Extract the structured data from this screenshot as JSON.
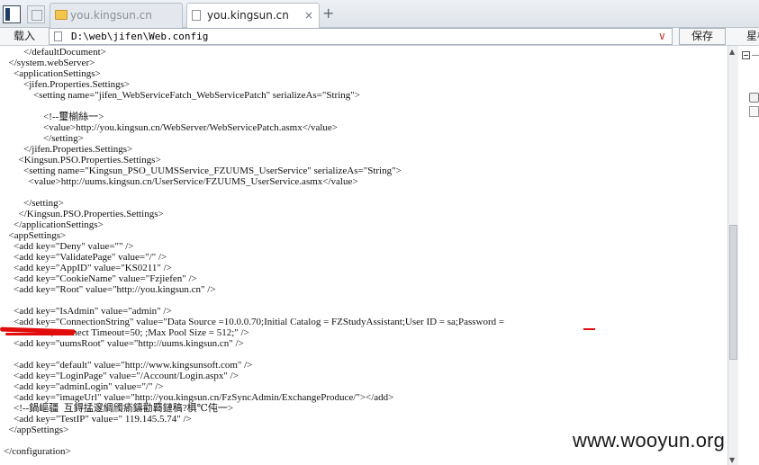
{
  "tabs": [
    {
      "label": "you.kingsun.cn",
      "icon": "folder-icon",
      "active": false
    },
    {
      "label": "you.kingsun.cn",
      "icon": "file-icon",
      "active": true
    }
  ],
  "tab_close_glyph": "×",
  "new_tab_glyph": "+",
  "toolbar": {
    "load_label": "载入",
    "path": "D:\\web\\jifen\\Web.config",
    "save_label": "保存",
    "right_panel_label": "星标"
  },
  "editor": {
    "lines": [
      "        </defaultDocument>",
      "  </system.webServer>",
      "    <applicationSettings>",
      "        <jifen.Properties.Settings>",
      "            <setting name=\"jifen_WebServiceFatch_WebServicePatch\" serializeAs=\"String\">",
      "",
      "                <!--璽椾絲一>",
      "                <value>http://you.kingsun.cn/WebServer/WebServicePatch.asmx</value>",
      "                </setting>",
      "        </jifen.Properties.Settings>",
      "      <Kingsun.PSO.Properties.Settings>",
      "        <setting name=\"Kingsun_PSO_UUMSService_FZUUMS_UserService\" serializeAs=\"String\">",
      "          <value>http://uums.kingsun.cn/UserService/FZUUMS_UserService.asmx</value>",
      "",
      "        </setting>",
      "      </Kingsun.PSO.Properties.Settings>",
      "    </applicationSettings>",
      "  <appSettings>",
      "    <add key=\"Deny\" value=\"\" />",
      "    <add key=\"ValidatePage\" value=\"/\" />",
      "    <add key=\"AppID\" value=\"KS0211\" />",
      "    <add key=\"CookieName\" value=\"Fzjiefen\" />",
      "    <add key=\"Root\" value=\"http://you.kingsun.cn\" />",
      "",
      "    <add key=\"IsAdmin\" value=\"admin\" />",
      "    <add key=\"ConnectionString\" value=\"Data Source =10.0.0.70;Initial Catalog = FZStudyAssistant;User ID = sa;Password =",
      "                   ; Connect Timeout=50; ;Max Pool Size = 512;\" />",
      "    <add key=\"uumsRoot\" value=\"http://uums.kingsun.cn\" />",
      "",
      "    <add key=\"default\" value=\"http://www.kingsunsoft.com\" />",
      "    <add key=\"LoginPage\" value=\"/Account/Login.aspx\" />",
      "    <add key=\"adminLogin\" value=\"/\" />",
      "    <add key=\"imageUrl\" value=\"http://you.kingsun.cn/FzSyncAdmin/ExchangeProduce/\"></add>",
      "    <!--鍋嶇疆  互鍀掹邃綢斶瘉鑄勸羇鏈稿?椇℃伅一>",
      "    <add key=\"TestIP\" value=\" 119.145.5.74\" />",
      "  </appSettings>",
      "",
      "</configuration>"
    ]
  },
  "scrollbar": {
    "position_fraction": 0.64,
    "visible_fraction": 0.34
  },
  "watermark": "www.wooyun.org",
  "colors": {
    "redaction": "#e10c0c",
    "dropdown_arrow": "#c0392b"
  }
}
